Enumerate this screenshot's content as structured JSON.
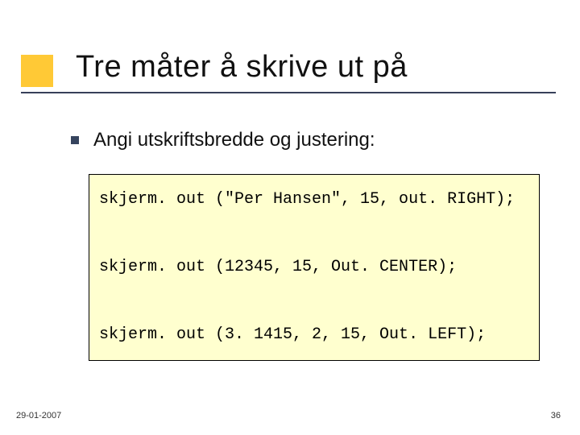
{
  "title": "Tre måter å skrive ut på",
  "bullet": "Angi utskriftsbredde og justering:",
  "code": "skjerm. out (\"Per Hansen\", 15, out. RIGHT);\n\nskjerm. out (12345, 15, Out. CENTER);\n\nskjerm. out (3. 1415, 2, 15, Out. LEFT);",
  "footer_date": "29-01-2007",
  "page_number": "36"
}
